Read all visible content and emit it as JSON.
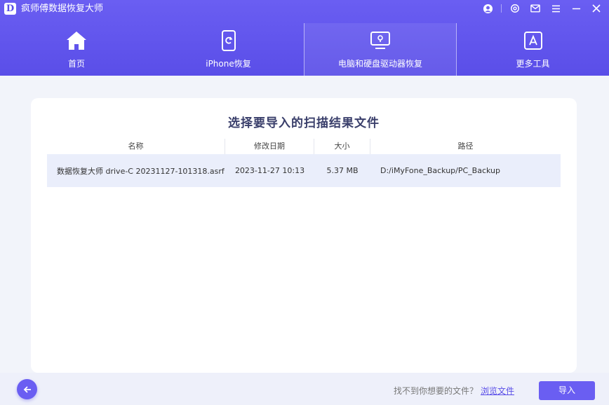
{
  "app": {
    "logo": "D",
    "title": "疯师傅数据恢复大师"
  },
  "window_controls": [
    "account-icon",
    "settings-icon",
    "mail-icon",
    "menu-icon",
    "minimize-icon",
    "close-icon"
  ],
  "nav": {
    "tabs": [
      {
        "label": "首页",
        "icon": "home-icon",
        "active": false
      },
      {
        "label": "iPhone恢复",
        "icon": "phone-recovery-icon",
        "active": false
      },
      {
        "label": "电脑和硬盘驱动器恢复",
        "icon": "computer-recovery-icon",
        "active": true
      },
      {
        "label": "更多工具",
        "icon": "app-store-icon",
        "active": false
      }
    ]
  },
  "dialog": {
    "title": "选择要导入的扫描结果文件",
    "columns": [
      "名称",
      "修改日期",
      "大小",
      "路径"
    ],
    "rows": [
      {
        "name": "数据恢复大师 drive-C 20231127-101318.asrf",
        "modified": "2023-11-27 10:13",
        "size": "5.37 MB",
        "path": "D:/iMyFone_Backup/PC_Backup"
      }
    ]
  },
  "footer": {
    "hint": "找不到你想要的文件？",
    "browse_link": "浏览文件",
    "import_label": "导入"
  },
  "colors": {
    "accent": "#5a4ee8",
    "header": "#6a5ef2",
    "row_highlight": "#eaeefb",
    "page_bg": "#f2f4fa"
  }
}
